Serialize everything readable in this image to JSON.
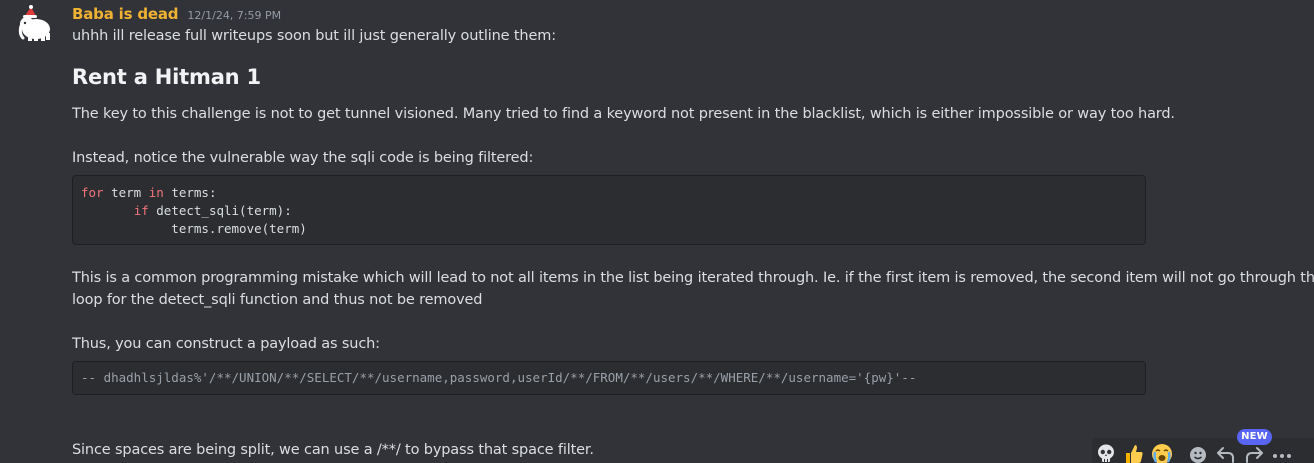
{
  "message": {
    "author": "Baba is dead",
    "timestamp": "12/1/24, 7:59 PM",
    "intro": "uhhh ill release full writeups soon but ill just generally outline them:",
    "heading": "Rent a Hitman 1",
    "para1": "The key to this challenge is not to get tunnel visioned. Many tried to find a keyword not present in the blacklist, which is either impossible or way too hard.",
    "para2": "Instead, notice the vulnerable way the sqli code is being filtered:",
    "code1": {
      "line1_kw1": "for",
      "line1_a": " term ",
      "line1_kw2": "in",
      "line1_b": " terms:",
      "line2_indent": "       ",
      "line2_kw": "if",
      "line2_rest": " detect_sqli(term):",
      "line3": "            terms.remove(term)"
    },
    "para3_line1": "This is a common programming mistake which will lead to not all items in the list being iterated through. Ie. if the first item is removed, the second item will not go through the",
    "para3_line2": "loop for the detect_sqli function and thus not be removed",
    "para4": "Thus, you can construct a payload as such:",
    "code2": "-- dhadhlsjldas%'/**/UNION/**/SELECT/**/username,password,userId/**/FROM/**/users/**/WHERE/**/username='{pw}'--",
    "para5": "Since spaces are being split, we can use a /**/ to bypass that space filter."
  },
  "toolbar": {
    "badge": "NEW",
    "icons": [
      "skull-emoji",
      "thumbs-up-emoji",
      "crying-emoji",
      "add-reaction-icon",
      "reply-icon",
      "forward-icon",
      "more-icon"
    ]
  },
  "colors": {
    "background": "#323339",
    "username": "#f0b232",
    "code_bg": "#2b2d31",
    "keyword": "#f3747a",
    "accent": "#5865f2"
  }
}
